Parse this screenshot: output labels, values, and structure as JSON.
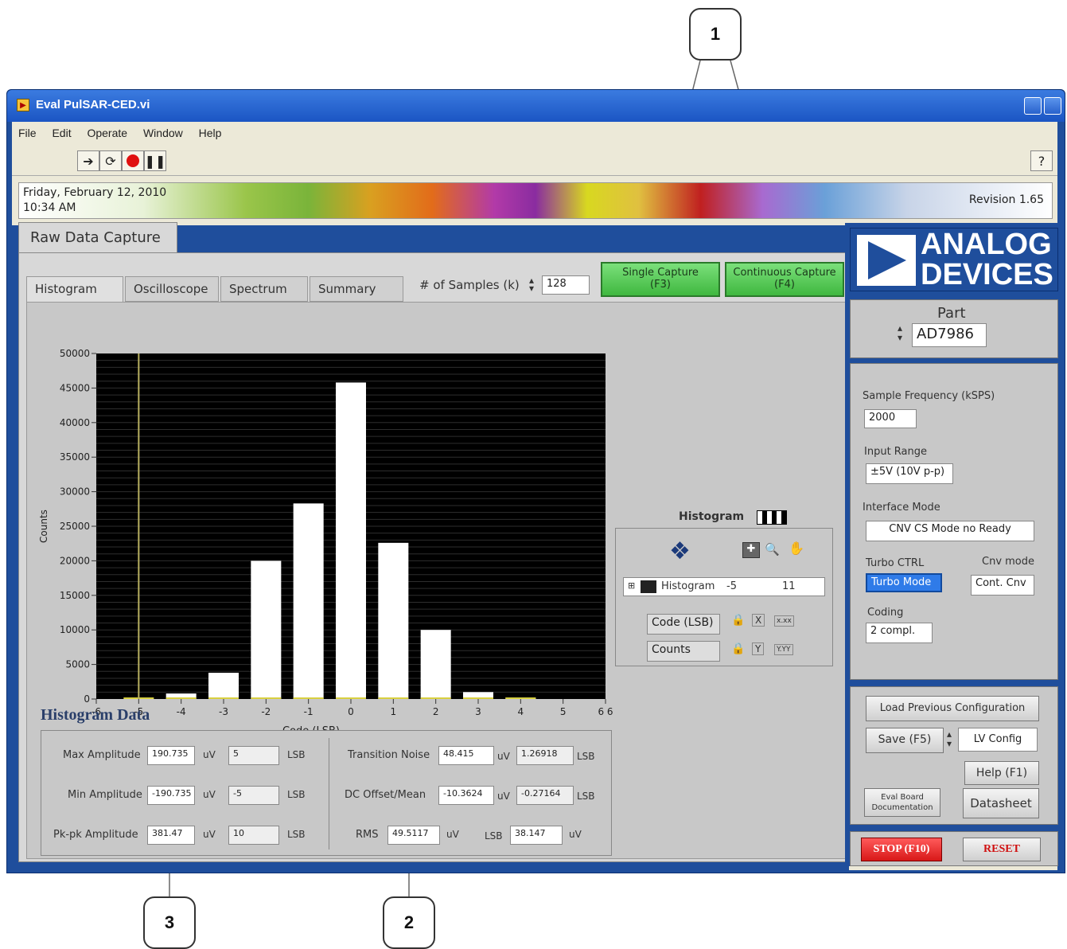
{
  "callouts": [
    "1",
    "2",
    "3"
  ],
  "window": {
    "title": "Eval PulSAR-CED.vi",
    "menu": [
      "File",
      "Edit",
      "Operate",
      "Window",
      "Help"
    ],
    "toolbar_icons": [
      "run-arrow-icon",
      "run-continuous-icon",
      "abort-icon",
      "pause-icon",
      "context-help-icon"
    ]
  },
  "banner": {
    "date": "Friday, February 12, 2010",
    "time": "10:34 AM",
    "revision": "Revision 1.65"
  },
  "main_tab": "Raw Data Capture",
  "inner_tabs": [
    "Histogram",
    "Oscilloscope",
    "Spectrum",
    "Summary"
  ],
  "samples": {
    "label": "# of Samples (k)",
    "value": "128"
  },
  "buttons": {
    "single_capture": [
      "Single Capture",
      "(F3)"
    ],
    "continuous_capture": [
      "Continuous Capture",
      "(F4)"
    ]
  },
  "chart_data": {
    "type": "bar",
    "xlabel": "Code (LSB)",
    "ylabel": "Counts",
    "ylim": [
      0,
      50000
    ],
    "xlim": [
      -6,
      6
    ],
    "x_ticks": [
      "-6",
      "-5",
      "-4",
      "-3",
      "-2",
      "-1",
      "0",
      "1",
      "2",
      "3",
      "4",
      "5",
      "6 6"
    ],
    "y_ticks": [
      "0",
      "5000",
      "10000",
      "15000",
      "20000",
      "25000",
      "30000",
      "35000",
      "40000",
      "45000",
      "50000"
    ],
    "categories": [
      -5,
      -4,
      -3,
      -2,
      -1,
      0,
      1,
      2,
      3,
      4
    ],
    "values": [
      0,
      800,
      3800,
      20000,
      28300,
      45800,
      22600,
      10000,
      1000,
      200
    ],
    "cursor_x": -5,
    "background": "#000000",
    "bar_color": "#ffffff",
    "cursor_color": "#b8b060"
  },
  "cursor_panel": {
    "title": "Histogram",
    "cursor_name": "Histogram",
    "cursor_x": "-5",
    "cursor_y": "11",
    "x_axis": "Code (LSB)",
    "y_axis": "Counts",
    "format_x": "x.xx",
    "format_y": "Y.YY"
  },
  "histogram_data": {
    "title": "Histogram Data",
    "rows_left": [
      {
        "label": "Max Amplitude",
        "uv": "190.735",
        "unit1": "uV",
        "lsb": "5",
        "unit2": "LSB"
      },
      {
        "label": "Min Amplitude",
        "uv": "-190.735",
        "unit1": "uV",
        "lsb": "-5",
        "unit2": "LSB"
      },
      {
        "label": "Pk-pk Amplitude",
        "uv": "381.47",
        "unit1": "uV",
        "lsb": "10",
        "unit2": "LSB"
      }
    ],
    "rows_right": [
      {
        "label": "Transition Noise",
        "uv": "48.415",
        "unit1": "uV",
        "lsb": "1.26918",
        "unit2": "LSB"
      },
      {
        "label": "DC Offset/Mean",
        "uv": "-10.3624",
        "unit1": "uV",
        "lsb": "-0.27164",
        "unit2": "LSB"
      }
    ],
    "rms": {
      "label": "RMS",
      "uv": "49.5117",
      "unit1": "uV",
      "lsb_label": "LSB",
      "lsb": "38.147",
      "unit2": "uV"
    }
  },
  "right_panel": {
    "logo_top": "ANALOG",
    "logo_bottom": "DEVICES",
    "part_label": "Part",
    "part_value": "AD7986",
    "sample_freq_label": "Sample Frequency (kSPS)",
    "sample_freq_value": "2000",
    "input_range_label": "Input Range",
    "input_range_value": "±5V (10V p-p)",
    "interface_mode_label": "Interface Mode",
    "interface_mode_value": "CNV CS Mode no Ready",
    "turbo_label": "Turbo CTRL",
    "turbo_value": "Turbo Mode",
    "cnv_label": "Cnv mode",
    "cnv_value": "Cont. Cnv",
    "coding_label": "Coding",
    "coding_value": "2 compl.",
    "load_config": "Load Previous Configuration",
    "save": "Save (F5)",
    "save_option": "LV Config",
    "help": "Help (F1)",
    "eval_doc": [
      "Eval Board",
      "Documentation"
    ],
    "datasheet": "Datasheet",
    "stop": "STOP (F10)",
    "reset": "RESET"
  }
}
